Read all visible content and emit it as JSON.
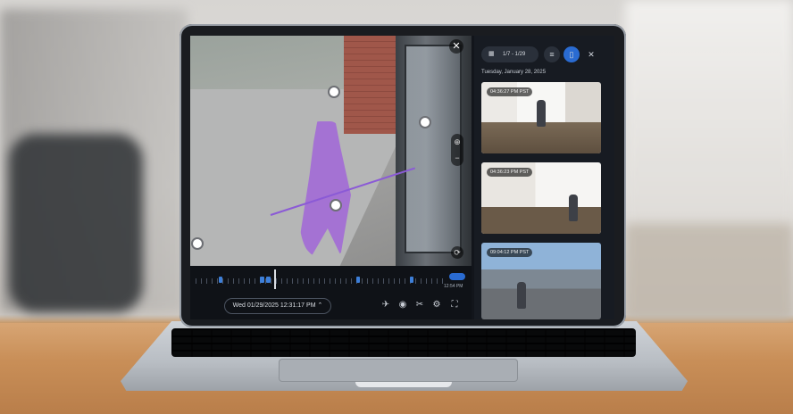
{
  "app": {
    "accent_color": "#2a6bd1",
    "highlight_color": "#a26ad6"
  },
  "player": {
    "close_icon": "close-icon",
    "zoom_icon": "zoom-icon",
    "rotate_icon": "rotate-icon",
    "timeline_end_time": "12:54 PM",
    "datetime": "Wed 01/29/2025  12:31:17 PM",
    "toolbar_icons": [
      "share-icon",
      "camera-icon",
      "clip-icon",
      "settings-icon",
      "fullscreen-icon"
    ]
  },
  "panel": {
    "date_range": "1/7 - 1/29",
    "date_heading": "Tuesday, January 28, 2025",
    "clips": [
      {
        "time": "04:36:27 PM PST"
      },
      {
        "time": "04:36:23 PM PST"
      },
      {
        "time": "09:04:12 PM PST"
      }
    ]
  }
}
